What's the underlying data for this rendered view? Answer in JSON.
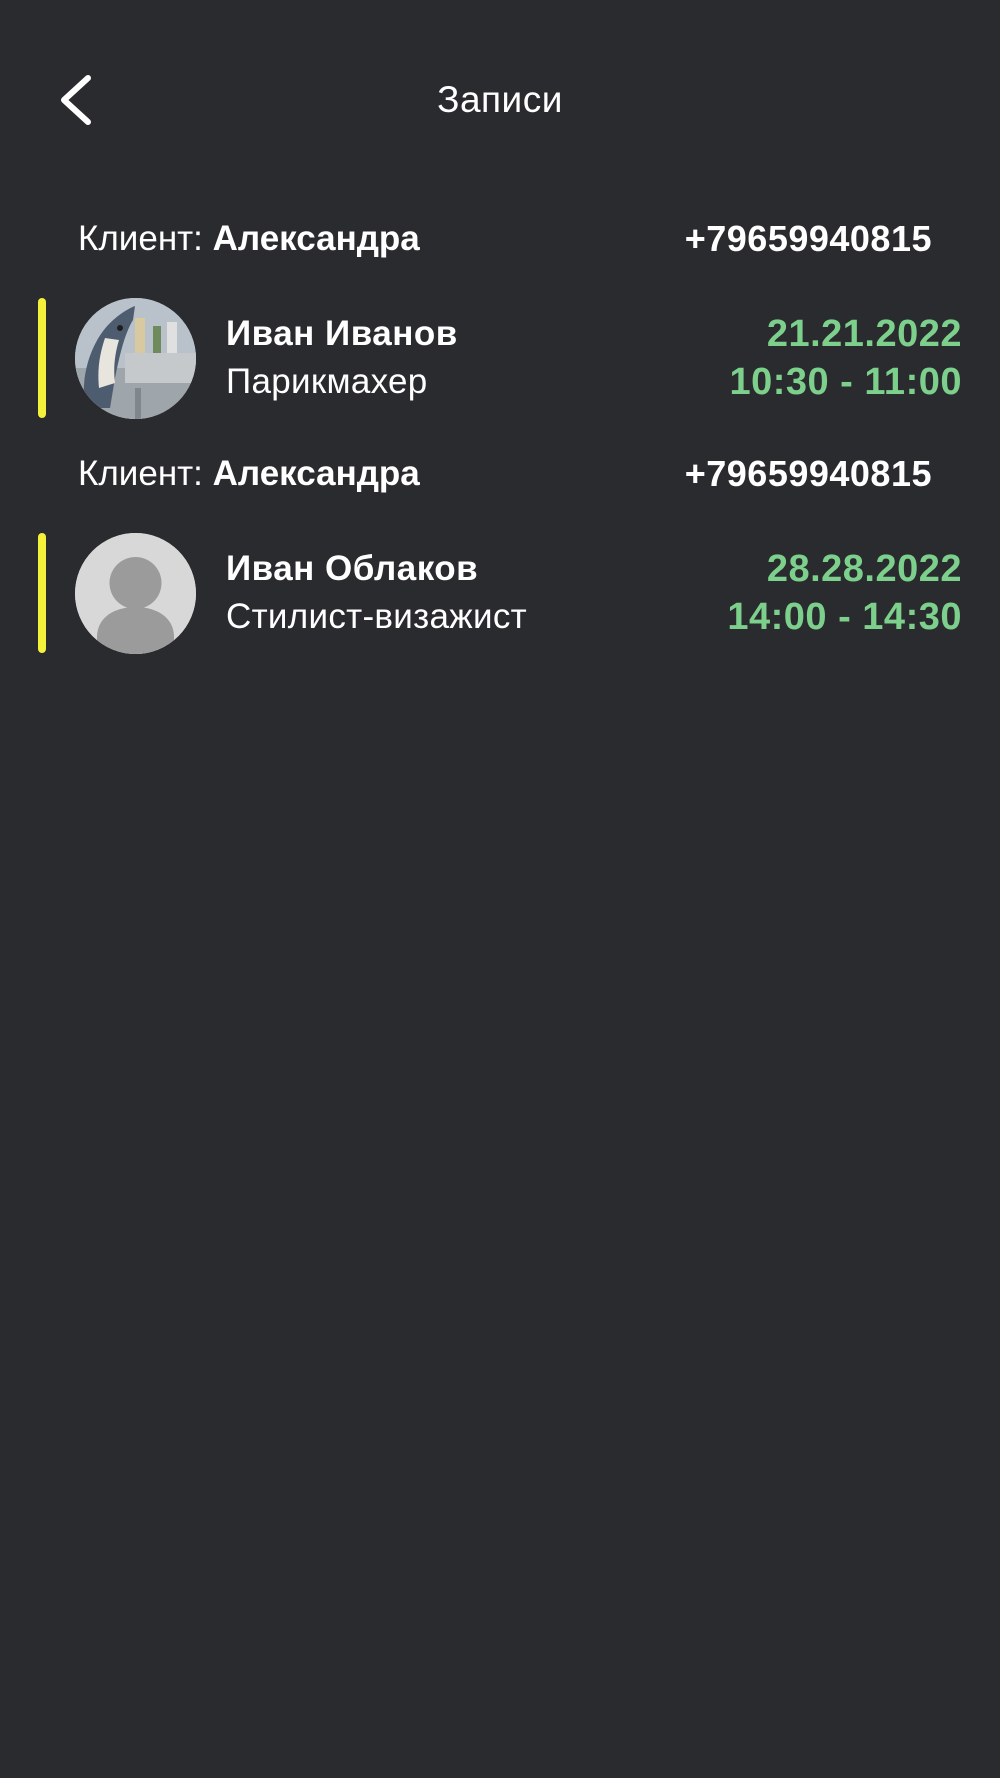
{
  "header": {
    "title": "Записи"
  },
  "bookings": [
    {
      "client_label": "Клиент: ",
      "client_name": "Александра",
      "client_phone": "+79659940815",
      "specialist_name": "Иван Иванов",
      "specialist_role": "Парикмахер",
      "date": "21.21.2022",
      "time": "10:30 - 11:00",
      "avatar": "photo"
    },
    {
      "client_label": "Клиент: ",
      "client_name": "Александра",
      "client_phone": "+79659940815",
      "specialist_name": "Иван Облаков",
      "specialist_role": "Стилист-визажист",
      "date": "28.28.2022",
      "time": "14:00 - 14:30",
      "avatar": "placeholder"
    }
  ],
  "colors": {
    "background": "#2a2b2f",
    "accent_bar": "#f4f13a",
    "datetime": "#7dcf8c"
  }
}
